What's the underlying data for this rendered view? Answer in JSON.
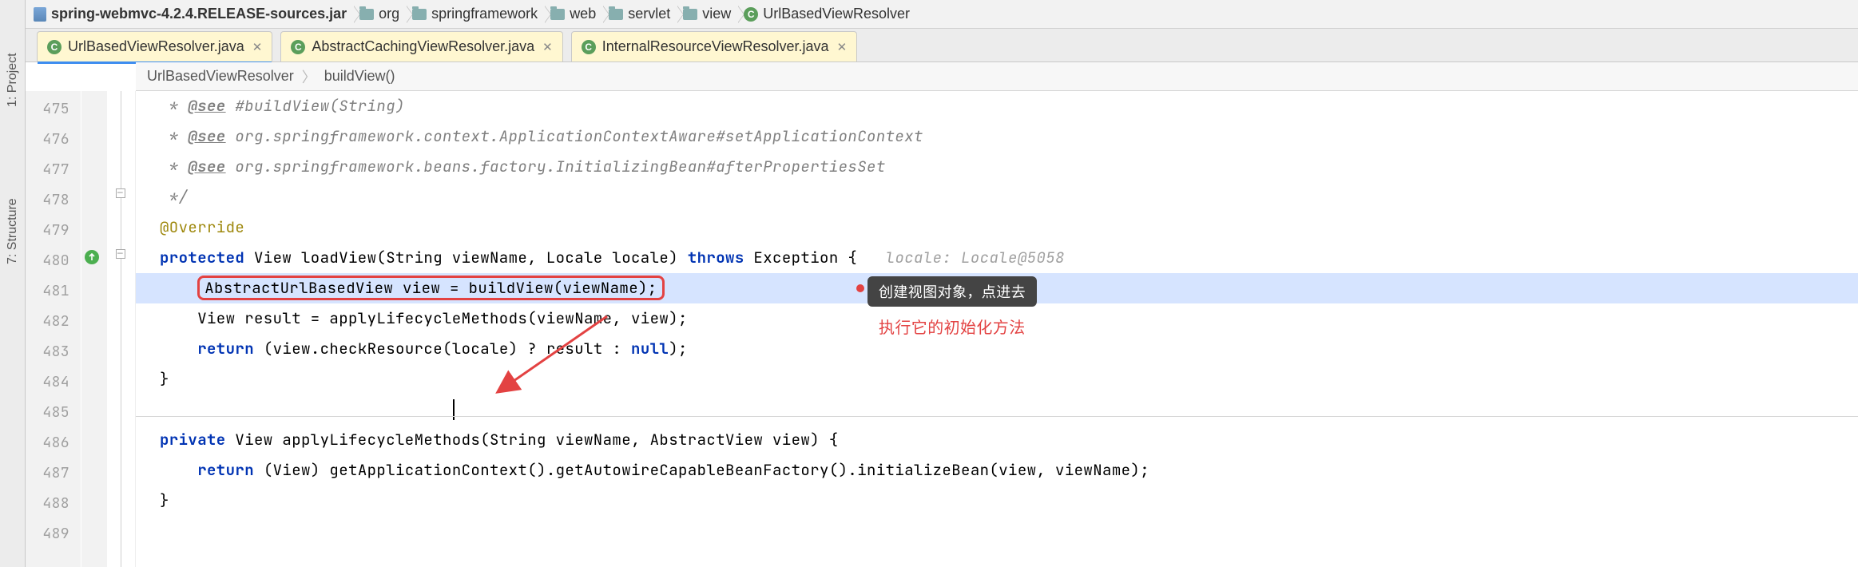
{
  "breadcrumb": [
    {
      "kind": "jar",
      "label": "spring-webmvc-4.2.4.RELEASE-sources.jar"
    },
    {
      "kind": "folder",
      "label": "org"
    },
    {
      "kind": "folder",
      "label": "springframework"
    },
    {
      "kind": "folder",
      "label": "web"
    },
    {
      "kind": "folder",
      "label": "servlet"
    },
    {
      "kind": "folder",
      "label": "view"
    },
    {
      "kind": "class",
      "label": "UrlBasedViewResolver"
    }
  ],
  "tabs": [
    {
      "label": "UrlBasedViewResolver.java",
      "active": true
    },
    {
      "label": "AbstractCachingViewResolver.java",
      "active": false
    },
    {
      "label": "InternalResourceViewResolver.java",
      "active": false
    }
  ],
  "method_crumb": {
    "class": "UrlBasedViewResolver",
    "method": "buildView()"
  },
  "line_start": 475,
  "side_rail": [
    {
      "label": "1: Project"
    },
    {
      "label": "7: Structure"
    }
  ],
  "annotations": {
    "tooltip": "创建视图对象，点进去",
    "red_note": "执行它的初始化方法",
    "hint": "locale: Locale@5058"
  },
  "code": {
    "l475": {
      "tag": "@see",
      "ref": "#buildView(String)"
    },
    "l476": {
      "tag": "@see",
      "ref": "org.springframework.context.ApplicationContextAware#setApplicationContext"
    },
    "l477": {
      "tag": "@see",
      "ref": "org.springframework.beans.factory.InitializingBean#afterPropertiesSet"
    },
    "l478": "*/",
    "l479": "@Override",
    "l480_kw": "protected",
    "l480_rest": " View loadView(String viewName, Locale locale) ",
    "l480_throws": "throws",
    "l480_exc": " Exception {",
    "l481": "AbstractUrlBasedView view = buildView(viewName);",
    "l482": "View result = applyLifecycleMethods(viewName, view);",
    "l483_kw": "return",
    "l483_rest": " (view.checkResource(locale) ? result : ",
    "l483_null": "null",
    "l483_end": ");",
    "l484": "}",
    "l486_kw": "private",
    "l486_rest": " View applyLifecycleMethods(String viewName, AbstractView view) {",
    "l487_kw": "return",
    "l487_rest": " (View) getApplicationContext().getAutowireCapableBeanFactory().initializeBean(view, viewName);",
    "l488": "}"
  }
}
